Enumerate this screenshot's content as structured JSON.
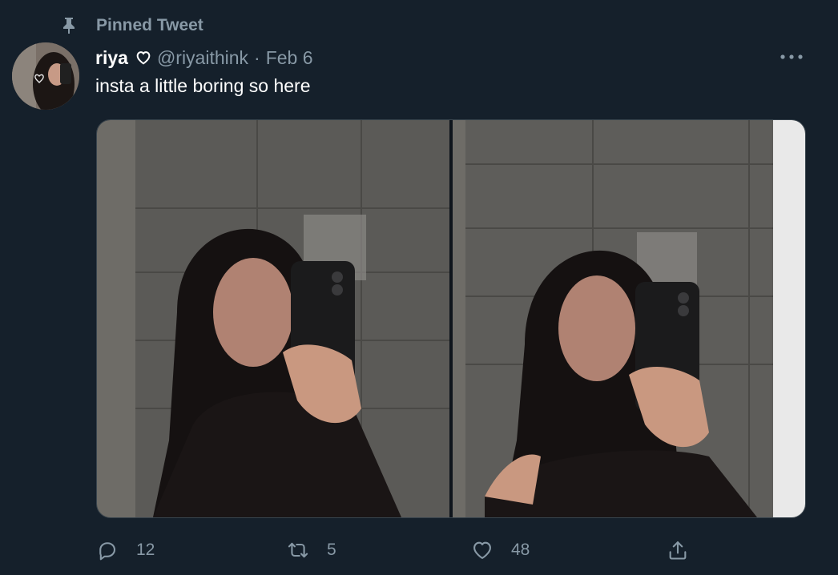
{
  "pinned": {
    "label": "Pinned Tweet"
  },
  "tweet": {
    "display_name": "riya",
    "handle": "@riyaithink",
    "separator": "·",
    "time": "Feb 6",
    "text": "insta a little boring so here"
  },
  "stats": {
    "replies": "12",
    "retweets": "5",
    "likes": "48"
  },
  "colors": {
    "background": "#15202b",
    "secondary_text": "#8899a6",
    "primary_text": "#ffffff"
  },
  "icons": [
    "pin-icon",
    "heart-outline-icon",
    "more-icon",
    "reply-icon",
    "retweet-icon",
    "like-icon",
    "share-icon"
  ]
}
